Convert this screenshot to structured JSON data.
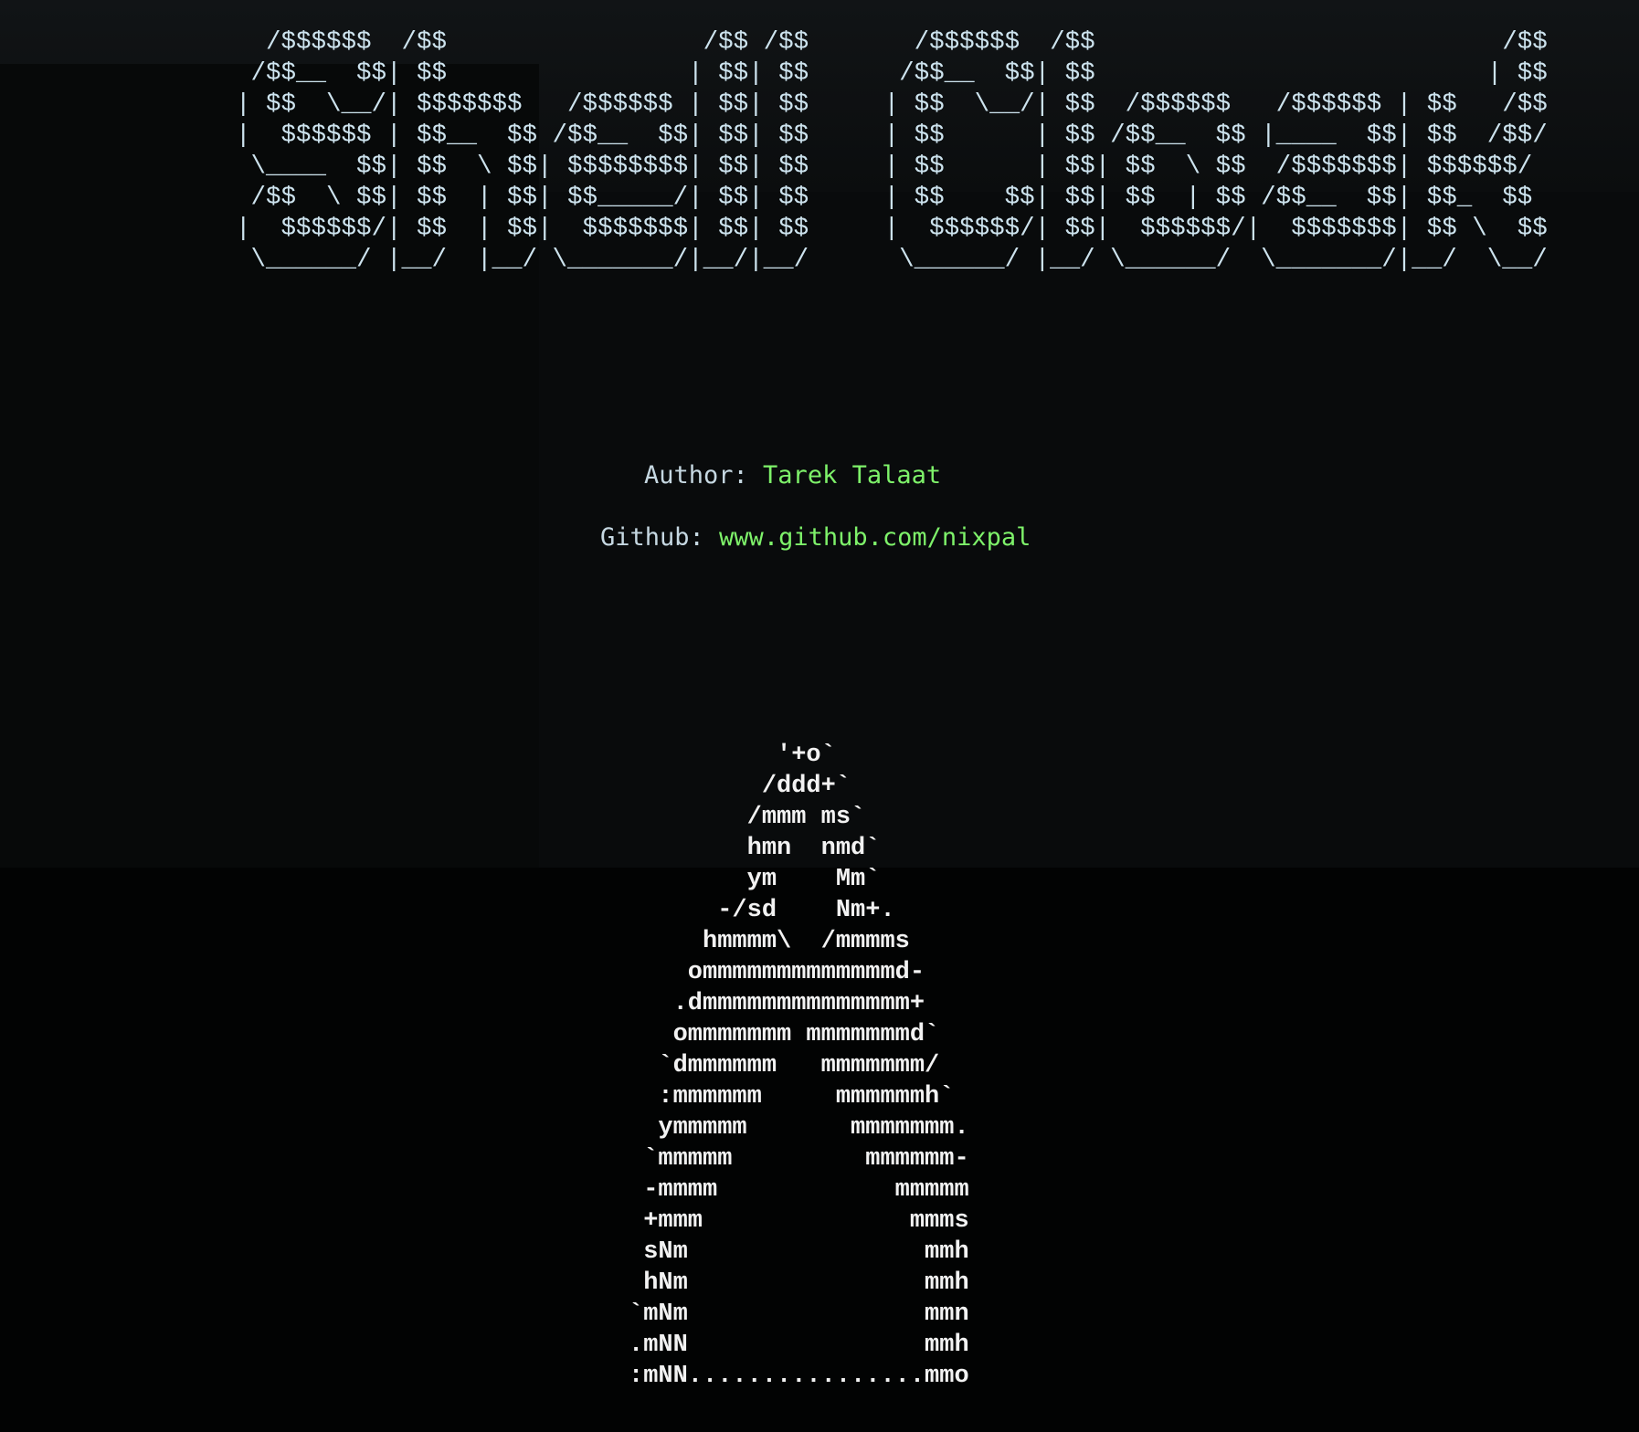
{
  "banner": {
    "ascii_title": "  /$$$$$$  /$$                 /$$ /$$       /$$$$$$  /$$                           /$$      \n /$$__  $$| $$                | $$| $$      /$$__  $$| $$                          | $$      \n| $$  \\__/| $$$$$$$   /$$$$$$ | $$| $$     | $$  \\__/| $$  /$$$$$$   /$$$$$$ | $$   /$$\n|  $$$$$$ | $$__  $$ /$$__  $$| $$| $$     | $$      | $$ /$$__  $$ |____  $$| $$  /$$/\n \\____  $$| $$  \\ $$| $$$$$$$$| $$| $$     | $$      | $$| $$  \\ $$  /$$$$$$$| $$$$$$/ \n /$$  \\ $$| $$  | $$| $$_____/| $$| $$     | $$    $$| $$| $$  | $$ /$$__  $$| $$_  $$ \n|  $$$$$$/| $$  | $$|  $$$$$$$| $$| $$     |  $$$$$$/| $$|  $$$$$$/|  $$$$$$$| $$ \\  $$\n \\______/ |__/  |__/ \\_______/|__/|__/      \\______/ |__/ \\______/  \\_______/|__/  \\__/"
  },
  "info": {
    "author_label": "Author: ",
    "author_value": "Tarek Talaat",
    "github_label": "Github: ",
    "github_value": "www.github.com/nixpal"
  },
  "art": {
    "ascii_figure": "          '+o`\n         /ddd+`\n        /mmm ms`\n        hmn  nmd`\n        ym    Mm`\n      -/sd    Nm+.\n     hmmmm\\  /mmmms\n    ommmmmmmmmmmmmd-\n   .dmmmmmmmmmmmmmm+\n   ommmmmmm mmmmmmmd`\n  `dmmmmmm   mmmmmmm/\n  :mmmmmm     mmmmmmh`\n  ymmmmm       mmmmmmm.\n `mmmmm         mmmmmm-\n -mmmm            mmmmm\n +mmm              mmms\n sNm                mmh\n hNm                mmh\n`mNm                mmn\n.mNN                mmh\n:mNN................mmo"
  },
  "colors": {
    "background": "#020303",
    "banner_text": "#cde3ee",
    "label_text": "#c6d8e2",
    "accent_green": "#7ef26a",
    "art_text": "#f2f2f2"
  }
}
